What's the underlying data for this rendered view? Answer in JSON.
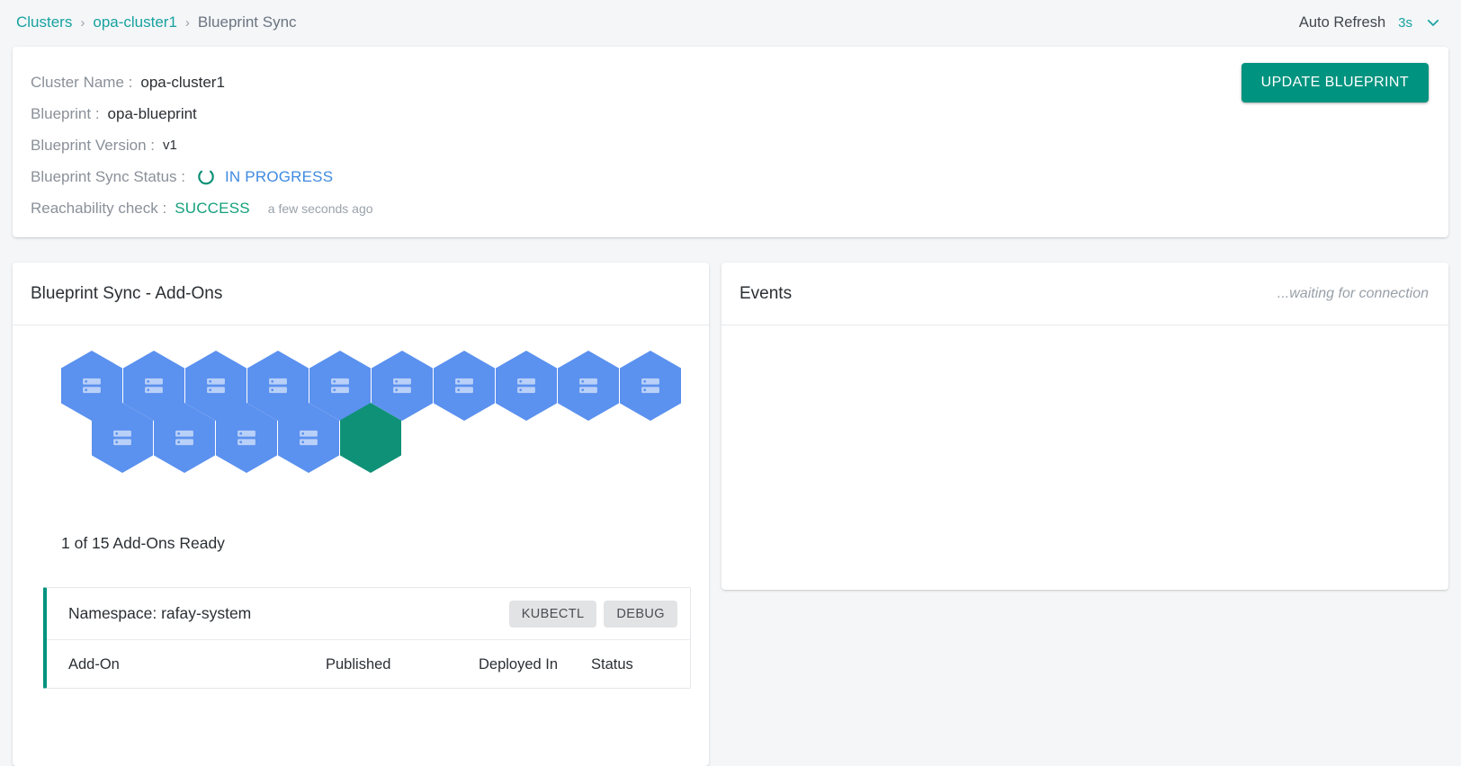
{
  "breadcrumb": {
    "items": [
      {
        "label": "Clusters",
        "type": "link"
      },
      {
        "label": "opa-cluster1",
        "type": "link"
      },
      {
        "label": "Blueprint Sync",
        "type": "current"
      }
    ],
    "separator": "›"
  },
  "topbar": {
    "auto_refresh_label": "Auto Refresh",
    "auto_refresh_value": "3s",
    "chevron_icon": "chevron-down-icon"
  },
  "cluster_info": {
    "cluster_name_label": "Cluster Name :",
    "cluster_name_value": "opa-cluster1",
    "blueprint_label": "Blueprint :",
    "blueprint_value": "opa-blueprint",
    "blueprint_version_label": "Blueprint Version :",
    "blueprint_version_value": "v1",
    "sync_status_label": "Blueprint Sync Status :",
    "sync_status_value": "IN PROGRESS",
    "sync_spinner_icon": "loading-spinner-icon",
    "reachability_label": "Reachability check :",
    "reachability_value": "SUCCESS",
    "reachability_time": "a few seconds ago",
    "update_button_label": "UPDATE BLUEPRINT"
  },
  "blueprint_sync": {
    "title": "Blueprint Sync - Add-Ons",
    "ready_count_text": "1 of 15 Add-Ons Ready",
    "hex_icon": "server-stack-icon",
    "hexagons": {
      "row1": [
        "pending",
        "pending",
        "pending",
        "pending",
        "pending",
        "pending",
        "pending",
        "pending",
        "pending",
        "pending"
      ],
      "row2": [
        "pending",
        "pending",
        "pending",
        "pending",
        "ready"
      ]
    },
    "namespace": {
      "title": "Namespace: rafay-system",
      "kubectl_label": "KUBECTL",
      "debug_label": "DEBUG",
      "table_headers": [
        "Add-On",
        "Published",
        "Deployed In",
        "Status"
      ]
    }
  },
  "events": {
    "title": "Events",
    "status_note": "...waiting for connection"
  },
  "colors": {
    "accent_teal": "#00937f",
    "link_teal": "#17a2a0",
    "hex_pending_blue": "#5b91ef",
    "hex_ready_green": "#0f9177",
    "status_inprogress_blue": "#3f8ae0",
    "status_success_green": "#14a07c",
    "page_background": "#f4f6f8"
  }
}
